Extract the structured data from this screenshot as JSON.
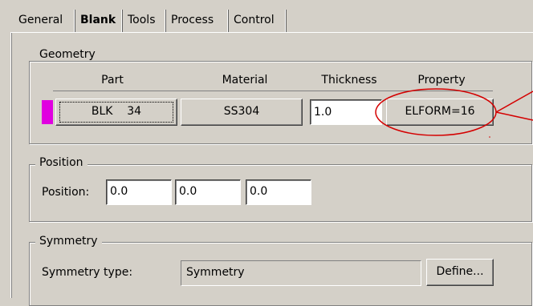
{
  "tabs": [
    {
      "label": "General",
      "active": false
    },
    {
      "label": "Blank",
      "active": true
    },
    {
      "label": "Tools",
      "active": false
    },
    {
      "label": "Process",
      "active": false
    },
    {
      "label": "Control",
      "active": false
    }
  ],
  "geometry": {
    "title": "Geometry",
    "headers": {
      "part": "Part",
      "material": "Material",
      "thickness": "Thickness",
      "property": "Property"
    },
    "part_color": "#e000e0",
    "part_button": "BLK    34",
    "material_button": "SS304",
    "thickness_value": "1.0",
    "property_button": "ELFORM=16"
  },
  "position": {
    "title": "Position",
    "label": "Position:",
    "values": [
      "0.0",
      "0.0",
      "0.0"
    ]
  },
  "symmetry": {
    "title": "Symmetry",
    "type_label": "Symmetry type:",
    "type_value": "Symmetry",
    "define_button": "Define..."
  },
  "annotation_color": "#d40000"
}
